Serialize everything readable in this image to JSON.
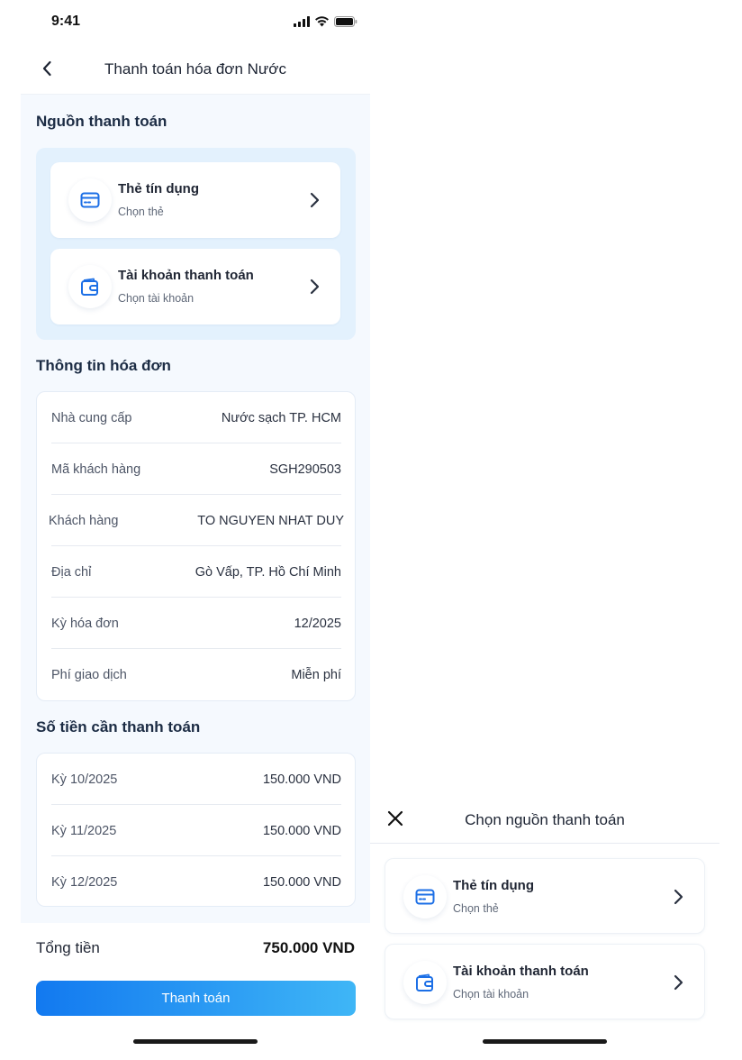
{
  "status_bar": {
    "time": "9:41"
  },
  "header": {
    "title": "Thanh toán hóa đơn Nước"
  },
  "payment_source": {
    "title": "Nguồn thanh toán",
    "options": [
      {
        "title": "Thẻ tín dụng",
        "subtitle": "Chọn thẻ",
        "icon": "credit-card-icon"
      },
      {
        "title": "Tài khoản thanh toán",
        "subtitle": "Chọn tài khoản",
        "icon": "wallet-icon"
      }
    ]
  },
  "bill_info": {
    "title": "Thông tin hóa đơn",
    "rows": [
      {
        "label": "Nhà cung cấp",
        "value": "Nước sạch TP. HCM"
      },
      {
        "label": "Mã khách hàng",
        "value": "SGH290503"
      },
      {
        "label": "Khách hàng",
        "value": "TO NGUYEN NHAT DUY"
      },
      {
        "label": "Địa chỉ",
        "value": "Gò Vấp, TP. Hồ Chí Minh"
      },
      {
        "label": "Kỳ hóa đơn",
        "value": "12/2025"
      },
      {
        "label": "Phí giao dịch",
        "value": "Miễn phí"
      }
    ]
  },
  "amount": {
    "title": "Số tiền cần thanh toán",
    "rows": [
      {
        "label": "Kỳ 10/2025",
        "value": "150.000 VND"
      },
      {
        "label": "Kỳ 11/2025",
        "value": "150.000 VND"
      },
      {
        "label": "Kỳ 12/2025",
        "value": "150.000 VND"
      }
    ]
  },
  "total": {
    "label": "Tổng tiền",
    "value": "750.000 VND"
  },
  "pay_button": {
    "label": "Thanh toán"
  },
  "sheet": {
    "title": "Chọn nguồn thanh toán",
    "options": [
      {
        "title": "Thẻ tín dụng",
        "subtitle": "Chọn thẻ",
        "icon": "credit-card-icon"
      },
      {
        "title": "Tài khoản thanh toán",
        "subtitle": "Chọn tài khoản",
        "icon": "wallet-icon"
      }
    ]
  },
  "colors": {
    "accent": "#1279f0",
    "accent_end": "#3fb6f6",
    "source_bg": "#e3f1fd",
    "page_bg": "#f5f9fe"
  }
}
